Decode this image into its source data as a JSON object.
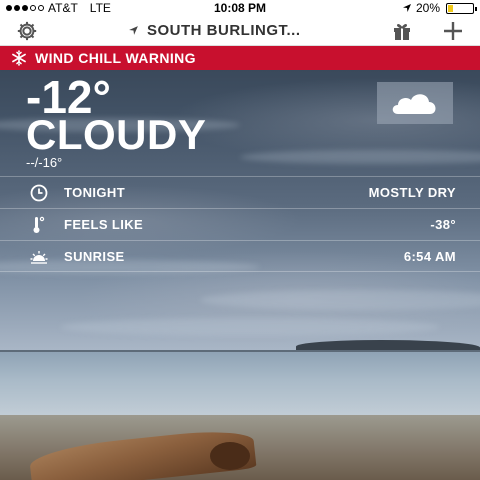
{
  "status_bar": {
    "carrier": "AT&T",
    "network": "LTE",
    "time": "10:08 PM",
    "battery": "20%",
    "battery_level": 0.2
  },
  "header": {
    "location": "SOUTH BURLINGT...",
    "icons": [
      "gear-icon",
      "location-arrow-icon",
      "gift-icon",
      "plus-icon"
    ]
  },
  "alert": {
    "label": "WIND CHILL WARNING",
    "icon": "snowflake-icon",
    "color": "#c8102e"
  },
  "current": {
    "temperature": "-12°",
    "condition": "CLOUDY",
    "hi_lo": "--/-16°",
    "icon": "cloud-icon"
  },
  "details": [
    {
      "icon": "clock-icon",
      "label": "TONIGHT",
      "value": "MOSTLY DRY"
    },
    {
      "icon": "thermometer-icon",
      "label": "FEELS LIKE",
      "value": "-38°"
    },
    {
      "icon": "sunrise-icon",
      "label": "SUNRISE",
      "value": "6:54 AM"
    }
  ]
}
